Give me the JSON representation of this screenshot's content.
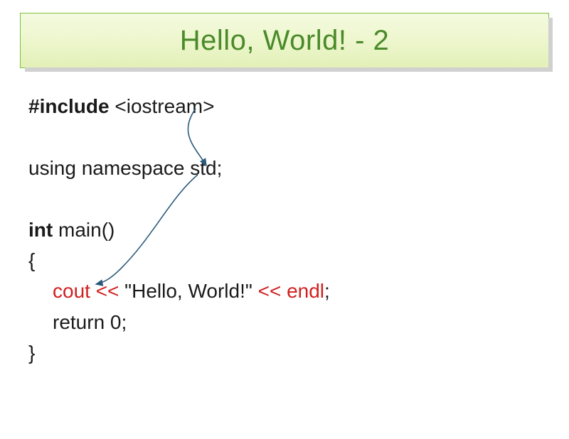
{
  "title": "Hello, World! - 2",
  "code": {
    "include_kw": "#include",
    "include_rest": " <iostream>",
    "using_line": "using namespace std;",
    "int_kw": "int",
    "main_rest": " main()",
    "brace_open": "{",
    "cout": "cout <<",
    "hello_str": " \"Hello, World!\" ",
    "endl": "<< endl",
    "semicolon": ";",
    "return_line": "return 0;",
    "brace_close": "}"
  }
}
